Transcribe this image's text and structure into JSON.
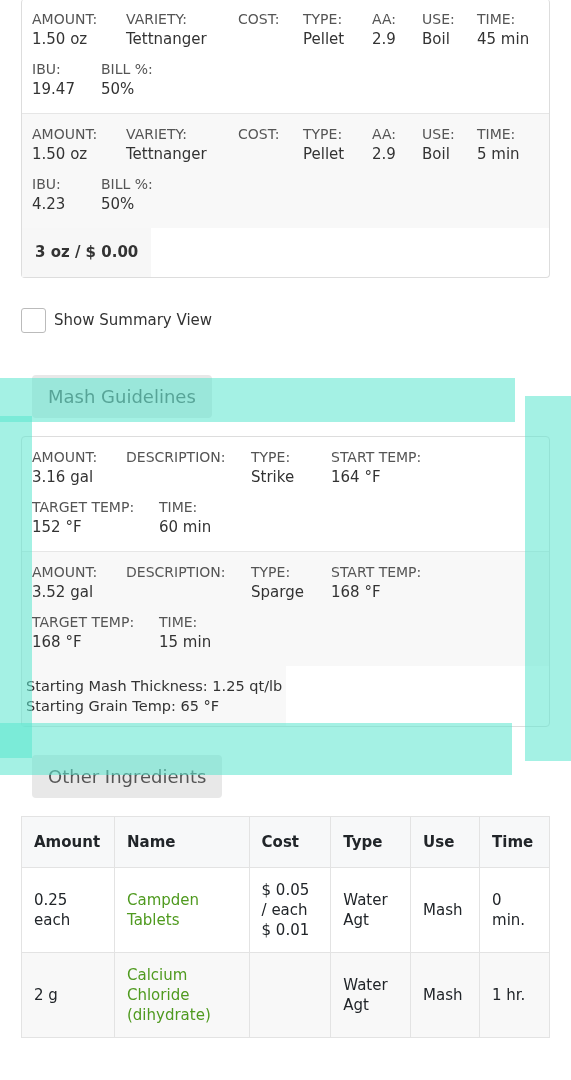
{
  "hops": {
    "items": [
      {
        "rows": [
          [
            {
              "label": "AMOUNT:",
              "value": "1.50 oz"
            },
            {
              "label": "VARIETY:",
              "value": "Tettnanger"
            },
            {
              "label": "COST:"
            },
            {
              "label": "TYPE:",
              "value": "Pellet"
            },
            {
              "label": "AA:",
              "value": "2.9"
            },
            {
              "label": "USE:",
              "value": "Boil"
            },
            {
              "label": "TIME:",
              "value": "45 min"
            }
          ],
          [
            {
              "label": "IBU:",
              "value": "19.47"
            },
            {
              "label": "BILL %:",
              "value": "50%"
            }
          ]
        ]
      },
      {
        "rows": [
          [
            {
              "label": "AMOUNT:",
              "value": "1.50 oz"
            },
            {
              "label": "VARIETY:",
              "value": "Tettnanger"
            },
            {
              "label": "COST:"
            },
            {
              "label": "TYPE:",
              "value": "Pellet"
            },
            {
              "label": "AA:",
              "value": "2.9"
            },
            {
              "label": "USE:",
              "value": "Boil"
            },
            {
              "label": "TIME:",
              "value": "5 min"
            }
          ],
          [
            {
              "label": "IBU:",
              "value": "4.23"
            },
            {
              "label": "BILL %:",
              "value": "50%"
            }
          ]
        ]
      }
    ],
    "total": "3 oz / $ 0.00"
  },
  "summary_toggle": {
    "label": "Show Summary View",
    "checked": false
  },
  "mash": {
    "title": "Mash Guidelines",
    "highlighted": true,
    "items": [
      {
        "rows": [
          [
            {
              "label": "AMOUNT:",
              "value": "3.16 gal"
            },
            {
              "label": "DESCRIPTION:"
            },
            {
              "label": "TYPE:",
              "value": "Strike"
            },
            {
              "label": "START TEMP:",
              "value": "164 °F"
            }
          ],
          [
            {
              "label": "TARGET TEMP:",
              "value": "152 °F"
            },
            {
              "label": "TIME:",
              "value": "60 min"
            }
          ]
        ]
      },
      {
        "rows": [
          [
            {
              "label": "AMOUNT:",
              "value": "3.52 gal"
            },
            {
              "label": "DESCRIPTION:"
            },
            {
              "label": "TYPE:",
              "value": "Sparge"
            },
            {
              "label": "START TEMP:",
              "value": "168 °F"
            }
          ],
          [
            {
              "label": "TARGET TEMP:",
              "value": "168 °F"
            },
            {
              "label": "TIME:",
              "value": "15 min"
            }
          ]
        ]
      }
    ],
    "notes": [
      "Starting Mash Thickness: 1.25 qt/lb",
      "Starting Grain Temp: 65 °F"
    ]
  },
  "other": {
    "title": "Other Ingredients",
    "columns": [
      "Amount",
      "Name",
      "Cost",
      "Type",
      "Use",
      "Time"
    ],
    "rows": [
      {
        "amount": "0.25 each",
        "name": "Campden Tablets",
        "cost": [
          "$ 0.05 / each",
          "$ 0.01"
        ],
        "type": "Water Agt",
        "use": "Mash",
        "time": "0 min."
      },
      {
        "amount": "2 g",
        "name": "Calcium Chloride (dihydrate)",
        "cost": [],
        "type": "Water Agt",
        "use": "Mash",
        "time": "1 hr."
      }
    ]
  }
}
